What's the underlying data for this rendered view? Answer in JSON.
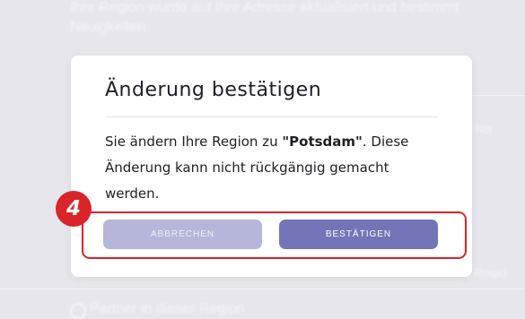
{
  "background": {
    "line1": "Ihre Region wurde auf Ihre Adresse aktualisiert und bestimmt",
    "line2": "Neuigkeiten",
    "right1": "Rb",
    "right2": "Regio",
    "bottom": "Partner in dieser Region"
  },
  "modal": {
    "title": "Änderung bestätigen",
    "body_prefix": "Sie ändern Ihre Region zu ",
    "region": "\"Potsdam\"",
    "body_suffix": ". Diese Änderung kann nicht rückgängig gemacht werden.",
    "cancel_label": "ABBRECHEN",
    "confirm_label": "BESTÄTIGEN"
  },
  "annotation": {
    "step_number": "4"
  },
  "colors": {
    "accent": "#7375b8",
    "accent_disabled": "#b5b6d9",
    "highlight": "#d9242a"
  }
}
